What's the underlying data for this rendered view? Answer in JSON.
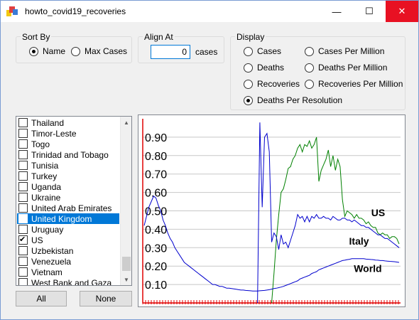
{
  "window": {
    "title": "howto_covid19_recoveries",
    "minimize": "—",
    "maximize": "☐",
    "close": "✕"
  },
  "sort_by": {
    "title": "Sort By",
    "options": [
      {
        "label": "Name",
        "selected": true
      },
      {
        "label": "Max Cases",
        "selected": false
      }
    ]
  },
  "align_at": {
    "title": "Align At",
    "value": "0",
    "unit": "cases"
  },
  "display": {
    "title": "Display",
    "options": [
      {
        "label": "Cases",
        "selected": false
      },
      {
        "label": "Deaths",
        "selected": false
      },
      {
        "label": "Recoveries",
        "selected": false
      },
      {
        "label": "Deaths Per Resolution",
        "selected": true
      },
      {
        "label": "Cases Per Million",
        "selected": false
      },
      {
        "label": "Deaths Per Million",
        "selected": false
      },
      {
        "label": "Recoveries Per Million",
        "selected": false
      }
    ]
  },
  "countries": [
    {
      "name": "Thailand",
      "checked": false,
      "selected": false
    },
    {
      "name": "Timor-Leste",
      "checked": false,
      "selected": false
    },
    {
      "name": "Togo",
      "checked": false,
      "selected": false
    },
    {
      "name": "Trinidad and Tobago",
      "checked": false,
      "selected": false
    },
    {
      "name": "Tunisia",
      "checked": false,
      "selected": false
    },
    {
      "name": "Turkey",
      "checked": false,
      "selected": false
    },
    {
      "name": "Uganda",
      "checked": false,
      "selected": false
    },
    {
      "name": "Ukraine",
      "checked": false,
      "selected": false
    },
    {
      "name": "United Arab Emirates",
      "checked": false,
      "selected": false
    },
    {
      "name": "United Kingdom",
      "checked": false,
      "selected": true
    },
    {
      "name": "Uruguay",
      "checked": false,
      "selected": false
    },
    {
      "name": "US",
      "checked": true,
      "selected": false
    },
    {
      "name": "Uzbekistan",
      "checked": false,
      "selected": false
    },
    {
      "name": "Venezuela",
      "checked": false,
      "selected": false
    },
    {
      "name": "Vietnam",
      "checked": false,
      "selected": false
    },
    {
      "name": "West Bank and Gaza",
      "checked": false,
      "selected": false
    }
  ],
  "buttons": {
    "all": "All",
    "none": "None"
  },
  "chart_data": {
    "type": "line",
    "title": "",
    "xlabel": "",
    "ylabel": "",
    "ylim": [
      0,
      1.0
    ],
    "yticks": [
      "0.90",
      "0.80",
      "0.70",
      "0.60",
      "0.50",
      "0.40",
      "0.30",
      "0.20",
      "0.10"
    ],
    "grid": true,
    "series": [
      {
        "name": "US",
        "color": "#008000",
        "values": [
          null,
          null,
          null,
          null,
          null,
          null,
          null,
          null,
          null,
          null,
          null,
          null,
          null,
          null,
          null,
          null,
          null,
          null,
          null,
          null,
          null,
          null,
          null,
          null,
          null,
          null,
          null,
          null,
          null,
          null,
          null,
          null,
          null,
          null,
          null,
          null,
          null,
          null,
          null,
          null,
          null,
          null,
          null,
          null,
          null,
          null,
          null,
          null,
          null,
          null,
          null,
          null,
          null,
          null,
          0.0,
          0.16,
          0.34,
          0.48,
          0.6,
          0.62,
          0.67,
          0.73,
          0.74,
          0.78,
          0.8,
          0.84,
          0.86,
          0.82,
          0.86,
          0.85,
          0.88,
          0.84,
          0.86,
          0.9,
          0.66,
          0.72,
          0.75,
          0.78,
          0.83,
          0.74,
          0.8,
          0.72,
          0.78,
          0.74,
          0.56,
          0.47,
          0.5,
          0.49,
          0.48,
          0.46,
          0.48,
          0.46,
          0.46,
          0.45,
          0.43,
          0.44,
          0.42,
          0.41,
          0.41,
          0.38,
          0.37,
          0.38,
          0.37,
          0.37,
          0.35,
          0.36,
          0.36,
          0.35,
          0.32
        ]
      },
      {
        "name": "Italy",
        "color": "#0000cd",
        "values": [
          null,
          null,
          null,
          null,
          null,
          null,
          null,
          null,
          null,
          null,
          null,
          null,
          null,
          null,
          null,
          null,
          null,
          null,
          null,
          null,
          null,
          null,
          null,
          null,
          null,
          null,
          null,
          null,
          null,
          null,
          null,
          null,
          null,
          null,
          null,
          null,
          null,
          null,
          null,
          null,
          null,
          null,
          null,
          null,
          null,
          null,
          null,
          null,
          0.0,
          0.98,
          0.52,
          0.9,
          0.92,
          0.82,
          0.33,
          0.38,
          0.36,
          0.29,
          0.37,
          0.32,
          0.33,
          0.3,
          0.34,
          0.38,
          0.42,
          0.48,
          0.46,
          0.47,
          0.44,
          0.47,
          0.44,
          0.47,
          0.46,
          0.48,
          0.46,
          0.46,
          0.47,
          0.46,
          0.46,
          0.45,
          0.47,
          0.46,
          0.45,
          0.45,
          0.46,
          0.46,
          0.45,
          0.45,
          0.44,
          0.45,
          0.44,
          0.43,
          0.42,
          0.42,
          0.41,
          0.41,
          0.4,
          0.39,
          0.38,
          0.37,
          0.37,
          0.36,
          0.35,
          0.35,
          0.34,
          0.33,
          0.32,
          0.31,
          0.3
        ]
      },
      {
        "name": "World",
        "color": "#0000cd",
        "values": [
          0.42,
          0.47,
          0.52,
          0.55,
          0.58,
          0.57,
          0.53,
          0.5,
          0.45,
          0.42,
          0.38,
          0.35,
          0.33,
          0.3,
          0.28,
          0.26,
          0.24,
          0.22,
          0.21,
          0.2,
          0.19,
          0.18,
          0.17,
          0.16,
          0.15,
          0.14,
          0.13,
          0.12,
          0.11,
          0.1,
          0.1,
          0.095,
          0.09,
          0.09,
          0.085,
          0.08,
          0.08,
          0.078,
          0.076,
          0.074,
          0.072,
          0.07,
          0.07,
          0.068,
          0.067,
          0.066,
          0.065,
          0.065,
          0.065,
          0.066,
          0.067,
          0.068,
          0.07,
          0.072,
          0.075,
          0.078,
          0.08,
          0.083,
          0.086,
          0.09,
          0.095,
          0.1,
          0.105,
          0.11,
          0.115,
          0.12,
          0.13,
          0.135,
          0.14,
          0.145,
          0.15,
          0.16,
          0.165,
          0.17,
          0.18,
          0.185,
          0.19,
          0.195,
          0.2,
          0.205,
          0.21,
          0.215,
          0.22,
          0.225,
          0.23,
          0.232,
          0.235,
          0.237,
          0.24,
          0.24,
          0.24,
          0.24,
          0.24,
          0.24,
          0.238,
          0.237,
          0.236,
          0.235,
          0.233,
          0.232,
          0.23,
          0.23,
          0.228,
          0.227,
          0.226,
          0.225,
          0.224,
          0.222,
          0.22
        ]
      }
    ],
    "annotations": [
      {
        "text": "US",
        "series": "US"
      },
      {
        "text": "Italy",
        "series": "Italy"
      },
      {
        "text": "World",
        "series": "World"
      }
    ]
  }
}
